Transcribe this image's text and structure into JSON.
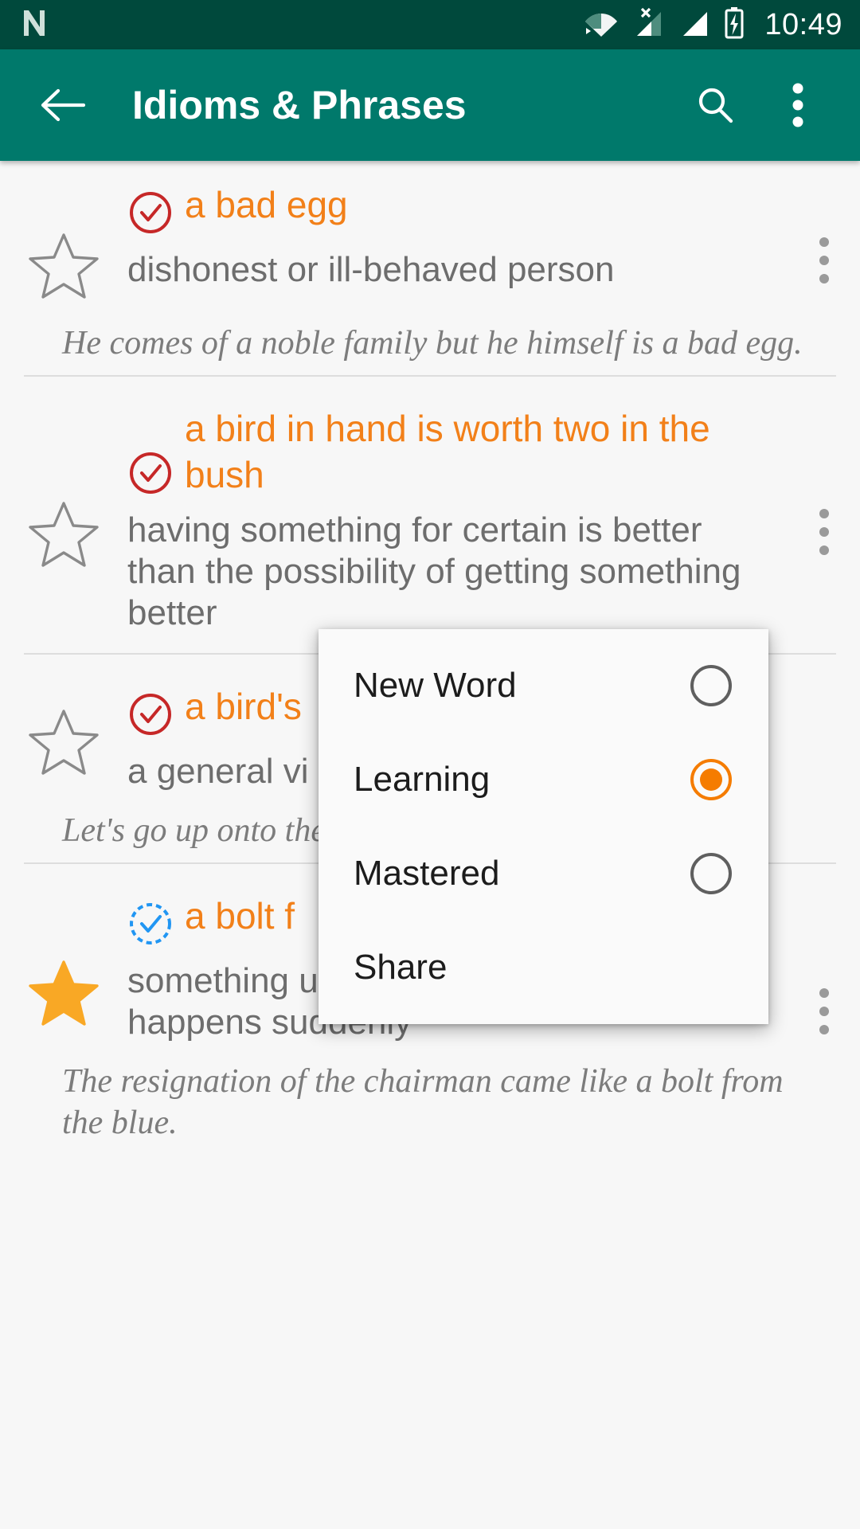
{
  "status_bar": {
    "time": "10:49",
    "icons": [
      "app-notification-icon",
      "wifi-icon",
      "signal-no-sim-icon",
      "signal-icon",
      "battery-charging-icon"
    ]
  },
  "app_bar": {
    "back_icon": "back-arrow-icon",
    "title": "Idioms & Phrases",
    "search_icon": "search-icon",
    "overflow_icon": "overflow-menu-icon"
  },
  "colors": {
    "status_bar_bg": "#00493c",
    "app_bar_bg": "#00796b",
    "accent_orange": "#f28019",
    "selected_radio": "#f57c00",
    "mastered_check": "#c62828",
    "learning_check": "#2196f3",
    "star_filled": "#f9a825",
    "page_bg": "#f7f7f7",
    "body_text": "#6d6d6d"
  },
  "entries": [
    {
      "phrase": "a bad egg",
      "meaning": "dishonest or ill-behaved person",
      "example": "He comes of a noble family but he himself is a bad egg.",
      "status_icon": "check-circle-solid-icon",
      "status_color": "#c62828",
      "favorite": false,
      "star_icon": "star-outline-icon"
    },
    {
      "phrase": "a bird in hand is worth two in the bush",
      "meaning": "having something for certain is better than the possibility of getting something better",
      "example": "",
      "status_icon": "check-circle-solid-icon",
      "status_color": "#c62828",
      "favorite": false,
      "star_icon": "star-outline-icon"
    },
    {
      "phrase": "a bird's",
      "meaning": "a general vi",
      "example": "Let's go up onto the view of the surroun",
      "status_icon": "check-circle-solid-icon",
      "status_color": "#c62828",
      "favorite": false,
      "star_icon": "star-outline-icon"
    },
    {
      "phrase": "a bolt f",
      "meaning": "something unexpected or surprising that happens suddenly",
      "example": "The resignation of the chairman came like a bolt from the blue.",
      "status_icon": "check-circle-dashed-icon",
      "status_color": "#2196f3",
      "favorite": true,
      "star_icon": "star-filled-icon"
    }
  ],
  "popup_menu": {
    "items": [
      {
        "label": "New Word",
        "control": "radio",
        "selected": false
      },
      {
        "label": "Learning",
        "control": "radio",
        "selected": true
      },
      {
        "label": "Mastered",
        "control": "radio",
        "selected": false
      },
      {
        "label": "Share",
        "control": "none",
        "selected": false
      }
    ]
  }
}
